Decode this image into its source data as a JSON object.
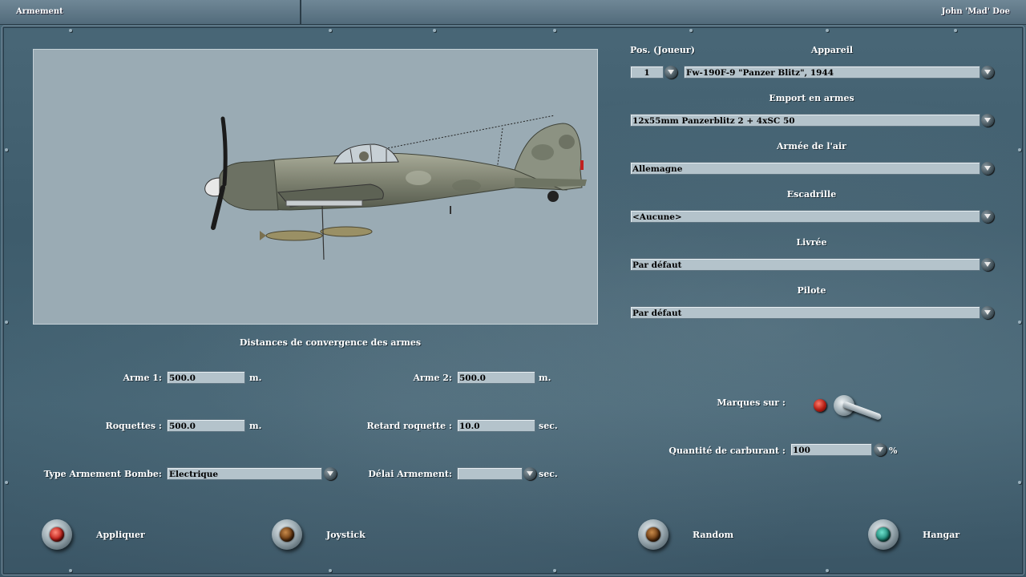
{
  "header": {
    "title": "Armement",
    "user": "John 'Mad' Doe"
  },
  "loadout": {
    "pos_label": "Pos. (Joueur)",
    "pos_value": "1",
    "aircraft_label": "Appareil",
    "aircraft_value": "Fw-190F-9 \"Panzer Blitz\", 1944",
    "weapons_label": "Emport en armes",
    "weapons_value": "12x55mm Panzerblitz 2 + 4xSC 50",
    "airforce_label": "Armée de l'air",
    "airforce_value": "Allemagne",
    "squadron_label": "Escadrille",
    "squadron_value": "<Aucune>",
    "livery_label": "Livrée",
    "livery_value": "Par défaut",
    "pilot_label": "Pilote",
    "pilot_value": "Par défaut"
  },
  "convergence": {
    "title": "Distances de convergence des armes",
    "weapon1_label": "Arme 1:",
    "weapon1_value": "500.0",
    "weapon2_label": "Arme 2:",
    "weapon2_value": "500.0",
    "rockets_label": "Roquettes :",
    "rockets_value": "500.0",
    "rocket_delay_label": "Retard roquette :",
    "rocket_delay_value": "10.0",
    "bomb_type_label": "Type Armement Bombe:",
    "bomb_type_value": "Electrique",
    "arming_delay_label": "Délai Armement:",
    "arming_delay_value": "",
    "unit_m": "m.",
    "unit_sec": "sec."
  },
  "options": {
    "markings_label": "Marques sur :",
    "fuel_label": "Quantité de carburant :",
    "fuel_value": "100",
    "fuel_unit": "%"
  },
  "buttons": {
    "apply": "Appliquer",
    "joystick": "Joystick",
    "random": "Random",
    "hangar": "Hangar"
  },
  "colors": {
    "apply_lamp": "#c0201a",
    "joystick_lamp": "#6a3a12",
    "random_lamp": "#6a3a12",
    "hangar_lamp": "#1f8a7a"
  }
}
